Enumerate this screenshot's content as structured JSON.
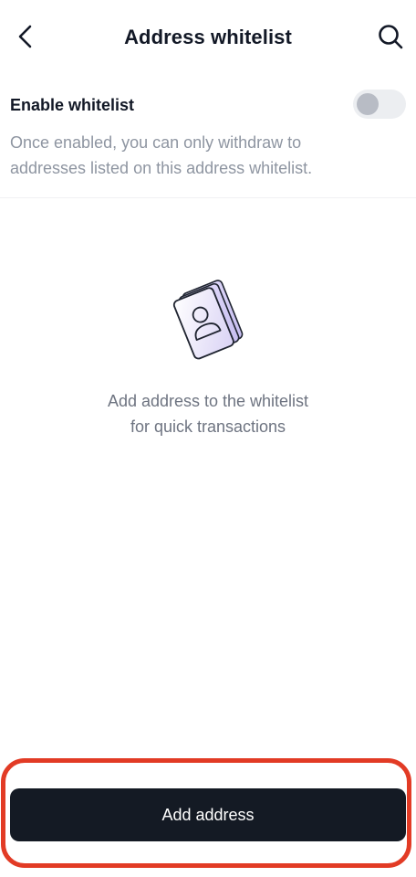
{
  "header": {
    "title": "Address whitelist",
    "back_icon": "chevron-left-icon",
    "search_icon": "search-icon"
  },
  "setting": {
    "label": "Enable whitelist",
    "enabled": false,
    "description_line1": "Once enabled, you can only withdraw to",
    "description_line2": "addresses listed on this address whitelist."
  },
  "empty_state": {
    "icon": "address-book-icon",
    "line1": "Add address to the whitelist",
    "line2": "for quick transactions"
  },
  "footer": {
    "button_label": "Add address",
    "highlight_color": "#e23b25"
  },
  "colors": {
    "primary_button": "#141a24",
    "text_primary": "#121826",
    "text_secondary": "#8e95a1"
  }
}
